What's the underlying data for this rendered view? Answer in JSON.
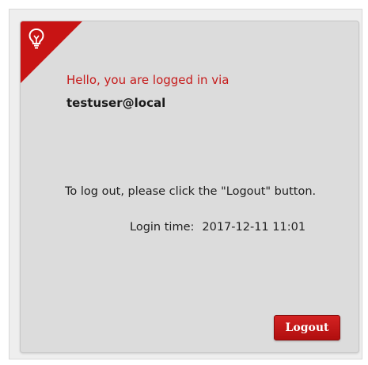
{
  "card": {
    "greeting": "Hello, you are logged in via",
    "user_id": "testuser@local",
    "instruction": "To log out, please click the \"Logout\" button.",
    "login_time_label": "Login time:",
    "login_time_value": "2017-12-11 11:01",
    "logout_label": "Logout",
    "badge_icon": "lightbulb-icon"
  },
  "colors": {
    "accent": "#c81414",
    "greeting_text": "#c61a1a",
    "card_background": "#dcdcdc"
  }
}
